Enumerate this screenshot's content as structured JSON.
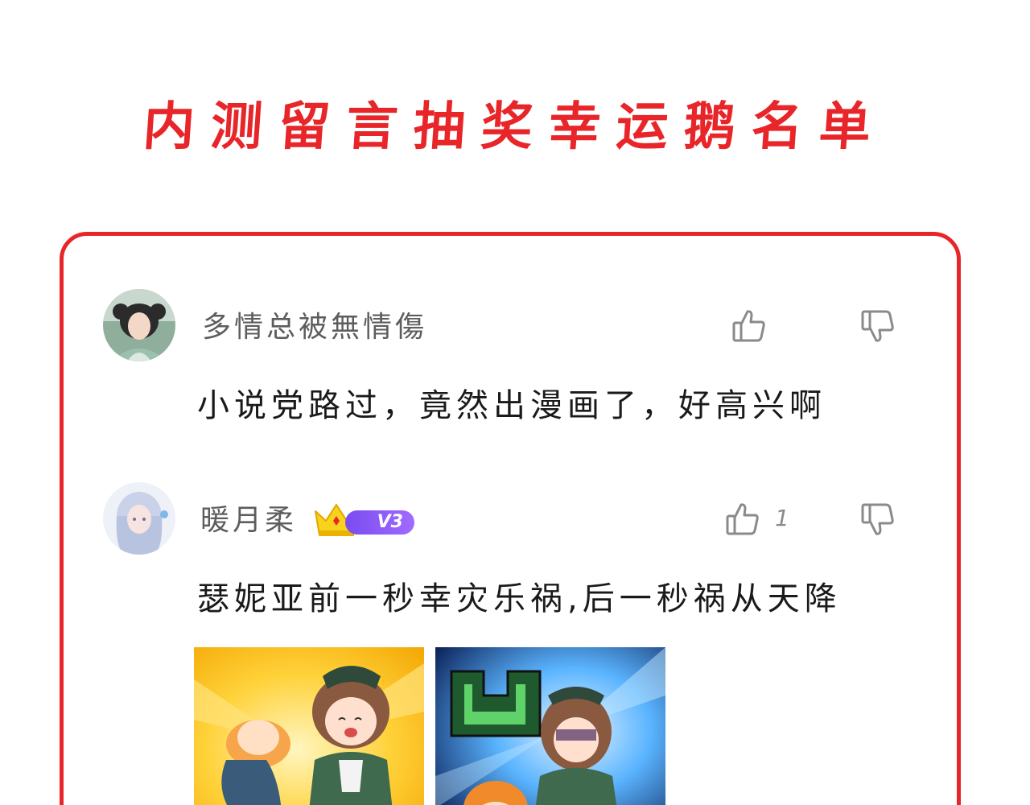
{
  "title": "内测留言抽奖幸运鹅名单",
  "comments": [
    {
      "username": "多情总被無情傷",
      "text": "小说党路过，竟然出漫画了，好高兴啊",
      "like_count": ""
    },
    {
      "username": "暖月柔",
      "badge_level": "V3",
      "text": "瑟妮亚前一秒幸灾乐祸,后一秒祸从天降",
      "like_count": "1"
    }
  ],
  "colors": {
    "accent": "#e8262a",
    "badge": "#8a5af5",
    "icon": "#8a8a8a"
  },
  "icons": [
    "thumb-up-icon",
    "thumb-down-icon",
    "crown-icon"
  ]
}
